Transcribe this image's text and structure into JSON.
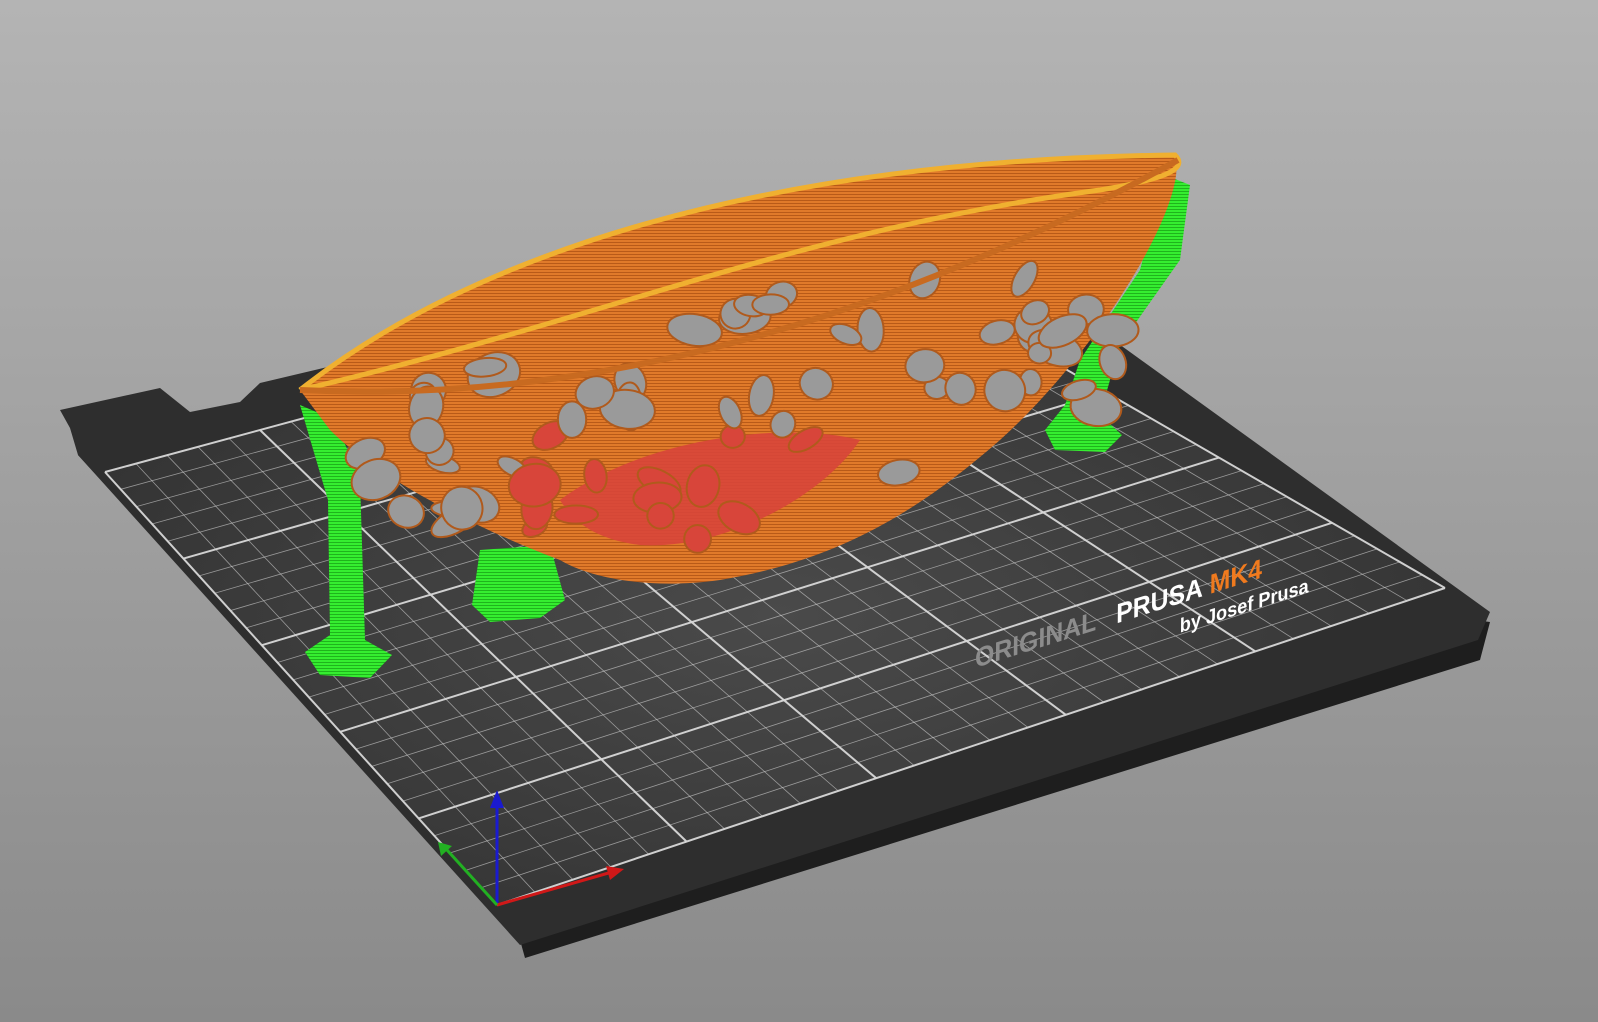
{
  "app": {
    "view": "3D preview"
  },
  "bed": {
    "logo_original": "ORIGINAL",
    "logo_prusa": "PRUSA",
    "logo_model": "MK4",
    "logo_byline": "by Josef Prusa",
    "grid_divisions": 25
  },
  "colors": {
    "background_top": "#b4b4b4",
    "background_bottom": "#8a8a8a",
    "bed_plate": "#2e2e2e",
    "bed_surface": "#3a3a3a",
    "grid_line": "#d8d8d8",
    "model_perimeter": "#e07a2a",
    "model_support": "#2ee62a",
    "model_infill": "#d8453a",
    "logo_gray": "#8c8c8c",
    "logo_white": "#ffffff",
    "logo_orange": "#f07a1e",
    "axis_x": "#d01818",
    "axis_y": "#22b022",
    "axis_z": "#1a1ad0"
  }
}
